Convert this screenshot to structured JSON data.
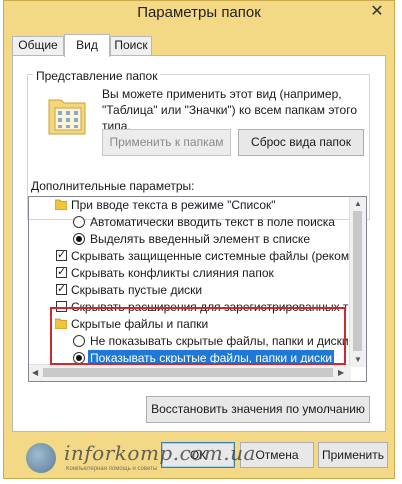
{
  "window": {
    "title": "Параметры папок",
    "close_glyph": "✕"
  },
  "tabs": [
    {
      "label": "Общие"
    },
    {
      "label": "Вид",
      "active": true
    },
    {
      "label": "Поиск"
    }
  ],
  "folder_view": {
    "group_label": "Представление папок",
    "description": "Вы можете применить этот вид (например, \"Таблица\" или \"Значки\") ко всем папкам этого типа.",
    "apply_button": "Применить к папкам",
    "reset_button": "Сброс вида папок"
  },
  "advanced": {
    "label": "Дополнительные параметры:",
    "items": [
      {
        "type": "folder",
        "label": "При вводе текста в режиме \"Список\"",
        "icon": "folder-icon"
      },
      {
        "type": "radio",
        "label": "Автоматически вводить текст в поле поиска",
        "checked": false
      },
      {
        "type": "radio",
        "label": "Выделять введенный элемент в списке",
        "checked": true
      },
      {
        "type": "checkbox",
        "label": "Скрывать защищенные системные файлы (рекомен",
        "checked": true
      },
      {
        "type": "checkbox",
        "label": "Скрывать конфликты слияния папок",
        "checked": true
      },
      {
        "type": "checkbox",
        "label": "Скрывать пустые диски",
        "checked": true
      },
      {
        "type": "checkbox",
        "label": "Скрывать расширения для зарегистрированных типо",
        "checked": false
      },
      {
        "type": "folder",
        "label": "Скрытые файлы и папки",
        "icon": "folder-icon"
      },
      {
        "type": "radio",
        "label": "Не показывать скрытые файлы, папки и диски",
        "checked": false
      },
      {
        "type": "radio",
        "label": "Показывать скрытые файлы, папки и диски",
        "checked": true,
        "selected": true
      }
    ],
    "check_glyph": "✓"
  },
  "restore_button": "Восстановить значения по умолчанию",
  "footer": {
    "ok": "ОК",
    "cancel": "Отмена",
    "apply": "Применить"
  },
  "watermark": {
    "text": "inforkomp.com.ua",
    "subtext": "Компьютерная помощь и советы"
  },
  "colors": {
    "window_frame": "#f3d985",
    "selection": "#1f78d4",
    "highlight_box": "#d1282e"
  }
}
